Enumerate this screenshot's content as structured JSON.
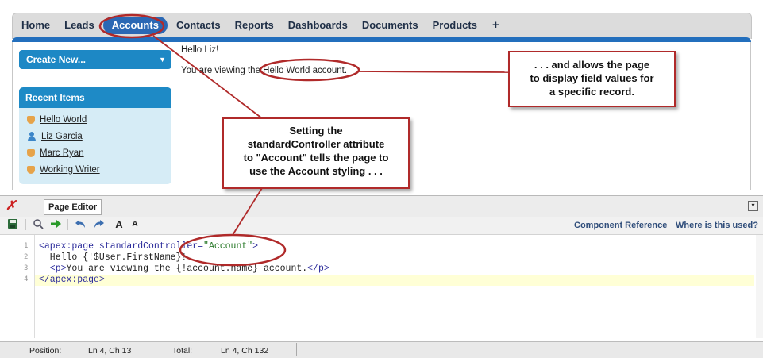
{
  "nav": {
    "tabs": [
      {
        "label": "Home"
      },
      {
        "label": "Leads"
      },
      {
        "label": "Accounts"
      },
      {
        "label": "Contacts"
      },
      {
        "label": "Reports"
      },
      {
        "label": "Dashboards"
      },
      {
        "label": "Documents"
      },
      {
        "label": "Products"
      },
      {
        "label": "+"
      }
    ],
    "active_tab": "Accounts"
  },
  "sidebar": {
    "create_new_label": "Create New...",
    "recent_items_title": "Recent Items",
    "recent_items": [
      {
        "label": "Hello World",
        "icon": "account-icon"
      },
      {
        "label": "Liz Garcia",
        "icon": "contact-icon"
      },
      {
        "label": "Marc Ryan",
        "icon": "account-icon"
      },
      {
        "label": "Working Writer",
        "icon": "account-icon"
      }
    ]
  },
  "main": {
    "greeting": "Hello Liz!",
    "viewing_text": "You are viewing the Hello World account."
  },
  "callouts": {
    "right_lines": [
      ". . . and allows the page",
      "to display field values for",
      "a specific record."
    ],
    "middle_lines": [
      "Setting the",
      "standardController attribute",
      "to \"Account\" tells the page to",
      "use the Account styling . . ."
    ]
  },
  "editor": {
    "tab_label": "Page Editor",
    "component_reference_label": "Component Reference",
    "where_used_label": "Where is this used?",
    "code_lines": [
      {
        "num": "1",
        "parts": [
          {
            "t": "<apex:page ",
            "c": "tag"
          },
          {
            "t": "standardController=",
            "c": "tag"
          },
          {
            "t": "\"Account\"",
            "c": "str"
          },
          {
            "t": ">",
            "c": "tag"
          }
        ]
      },
      {
        "num": "2",
        "parts": [
          {
            "t": "  Hello {!$User.FirstName}!",
            "c": ""
          }
        ]
      },
      {
        "num": "3",
        "parts": [
          {
            "t": "  <p>",
            "c": "tag"
          },
          {
            "t": "You are viewing the {!account.name} account.",
            "c": ""
          },
          {
            "t": "</p>",
            "c": "tag"
          }
        ]
      },
      {
        "num": "4",
        "parts": [
          {
            "t": "</apex:page>",
            "c": "tag"
          }
        ]
      }
    ]
  },
  "status": {
    "position_label": "Position:",
    "position_value": "Ln 4, Ch 13",
    "total_label": "Total:",
    "total_value": "Ln 4, Ch 132"
  },
  "colors": {
    "accent_blue": "#2b68b4",
    "sidebar_blue": "#1e8ac6",
    "callout_border": "#b02a2a"
  }
}
